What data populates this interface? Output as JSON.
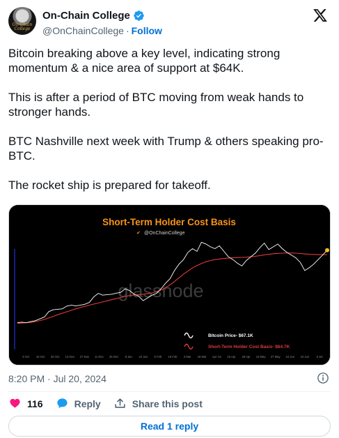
{
  "author": {
    "display_name": "On-Chain College",
    "handle": "@OnChainCollege",
    "separator": "·",
    "follow_label": "Follow",
    "avatar_caption": "On-Chain College"
  },
  "tweet": {
    "paragraphs": [
      "Bitcoin breaking above a key level, indicating strong momentum & a nice area of support at $64K.",
      "This is after a period of BTC moving from weak hands to stronger hands.",
      "BTC Nashville next week with Trump & others speaking pro-BTC.",
      "The rocket ship is prepared for takeoff."
    ],
    "timestamp": "8:20 PM · Jul 20, 2024"
  },
  "engagement": {
    "likes": "116",
    "reply_label": "Reply",
    "share_label": "Share this post",
    "read_replies_label": "Read 1 reply"
  },
  "icons": {
    "verified": "verified-badge-icon",
    "x_logo": "x-logo-icon",
    "info": "info-icon",
    "heart": "heart-icon",
    "reply": "reply-bubble-icon",
    "share": "share-icon"
  },
  "colors": {
    "accent": "#006fd6",
    "like": "#f91880",
    "price_line": "#ffffff",
    "holder_line": "#e03a3a",
    "chart_title": "#f7931a"
  },
  "chart_data": {
    "type": "line",
    "title": "Short-Term Holder Cost Basis",
    "subtitle": "@OnChainCollege",
    "watermark": "glassnode",
    "x_tick_labels": [
      "3 Oct",
      "16 Oct",
      "30 Oct",
      "13 Nov",
      "27 Nov",
      "11 Dec",
      "25 Dec",
      "8 Jan",
      "22 Jan",
      "5 Feb",
      "19 Feb",
      "4 Mar",
      "18 Mar",
      "Apr '24",
      "15 Apr",
      "29 Apr",
      "13 May",
      "27 May",
      "10 Jun",
      "24 Jun",
      "8 Jul"
    ],
    "series": [
      {
        "name": "Bitcoin Price- $67.1K",
        "color": "#ffffff",
        "values": [
          27.5,
          27.7,
          27.4,
          28.0,
          28.5,
          29.5,
          30.5,
          33.5,
          34.5,
          34.8,
          35.0,
          36.5,
          37.0,
          36.6,
          37.0,
          37.5,
          38.5,
          41.5,
          43.5,
          42.5,
          42.8,
          43.0,
          43.6,
          44.0,
          46.0,
          45.0,
          43.0,
          42.0,
          39.5,
          41.0,
          42.5,
          43.5,
          46.0,
          49.0,
          51.5,
          56.0,
          59.5,
          62.0,
          66.0,
          68.0,
          66.5,
          71.5,
          70.5,
          69.0,
          68.0,
          69.5,
          66.5,
          63.5,
          62.0,
          60.0,
          58.5,
          61.5,
          63.5,
          65.5,
          68.5,
          71.0,
          67.5,
          69.0,
          70.5,
          68.0,
          66.0,
          64.5,
          63.0,
          60.5,
          56.0,
          57.5,
          59.5,
          62.0,
          64.5,
          67.1
        ]
      },
      {
        "name": "Short-Term Holder Cost Basis- $64.7K",
        "color": "#e03a3a",
        "values": [
          27.0,
          27.2,
          27.4,
          27.6,
          28.0,
          28.6,
          29.2,
          30.0,
          30.9,
          31.8,
          32.6,
          33.4,
          34.2,
          35.0,
          35.7,
          36.4,
          37.0,
          37.6,
          38.2,
          38.8,
          39.4,
          40.0,
          40.6,
          41.2,
          41.8,
          42.3,
          42.6,
          42.8,
          43.0,
          43.3,
          43.7,
          44.4,
          45.3,
          46.6,
          48.2,
          50.0,
          52.0,
          54.0,
          55.8,
          57.4,
          58.7,
          59.8,
          60.8,
          61.5,
          62.0,
          62.3,
          62.6,
          62.8,
          63.0,
          63.1,
          63.2,
          63.3,
          63.5,
          63.8,
          64.2,
          64.6,
          64.9,
          65.2,
          65.4,
          65.5,
          65.6,
          65.6,
          65.5,
          65.3,
          65.1,
          64.9,
          64.8,
          64.7,
          64.7,
          64.7
        ]
      }
    ],
    "y_unit": "USD thousands",
    "legend_position": "bottom-right",
    "grid": false
  }
}
